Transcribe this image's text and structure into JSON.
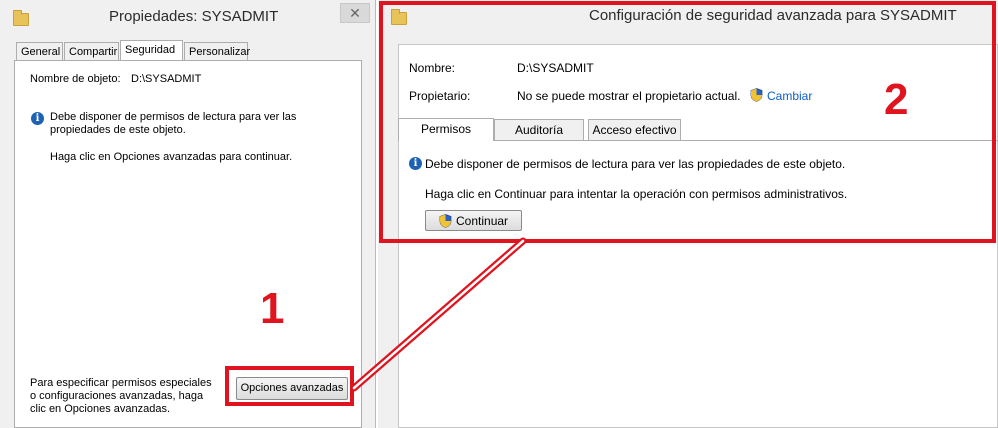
{
  "left_dialog": {
    "title": "Propiedades: SYSADMIT",
    "close_glyph": "✕",
    "tabs": [
      {
        "label": "General"
      },
      {
        "label": "Compartir"
      },
      {
        "label": "Seguridad"
      },
      {
        "label": "Personalizar"
      }
    ],
    "object_name_label": "Nombre de objeto:",
    "object_name_value": "D:\\SYSADMIT",
    "info_message": "Debe disponer de permisos de lectura para ver las propiedades de este objeto.",
    "info_hint": "Haga clic en Opciones avanzadas para continuar.",
    "special_perms_text": "Para especificar permisos especiales o configuraciones avanzadas, haga clic en Opciones avanzadas.",
    "advanced_button": "Opciones avanzadas"
  },
  "right_dialog": {
    "title": "Configuración de seguridad avanzada para SYSADMIT",
    "name_label": "Nombre:",
    "name_value": "D:\\SYSADMIT",
    "owner_label": "Propietario:",
    "owner_value": "No se puede mostrar el propietario actual.",
    "change_link": "Cambiar",
    "tabs": [
      {
        "label": "Permisos"
      },
      {
        "label": "Auditoría"
      },
      {
        "label": "Acceso efectivo"
      }
    ],
    "info_message": "Debe disponer de permisos de lectura para ver las propiedades de este objeto.",
    "continue_hint": "Haga clic en Continuar para intentar la operación con permisos administrativos.",
    "continue_button": "Continuar"
  },
  "annotations": {
    "label_1": "1",
    "label_2": "2",
    "highlight_color": "#e0141e"
  },
  "colors": {
    "info_icon": "#1e62b4",
    "link": "#0b5fc7",
    "folder": "#e8c35a"
  },
  "icons": [
    "folder-icon",
    "close-icon",
    "info-icon",
    "shield-icon"
  ]
}
